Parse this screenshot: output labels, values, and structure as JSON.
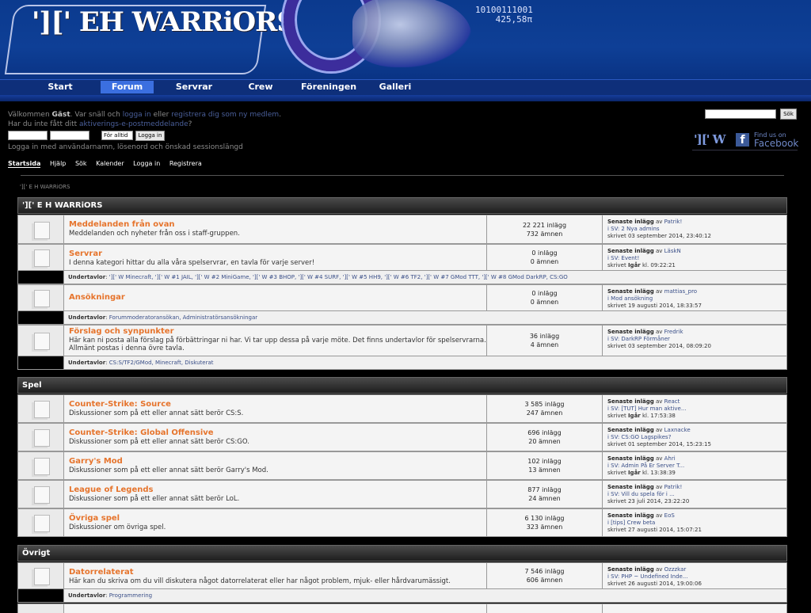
{
  "header": {
    "logo_text": "'][' EH WARRiORS",
    "binary_line1": "10100111001",
    "binary_line2": "425,58π"
  },
  "nav": {
    "items": [
      "Start",
      "Forum",
      "Servrar",
      "Crew",
      "Föreningen",
      "Galleri"
    ],
    "active": "Forum"
  },
  "welcome": {
    "prefix": "Välkommen",
    "guest": "Gäst",
    "please": ". Var snäll och",
    "login_link": "logga in",
    "or": "eller",
    "register_link": "registrera dig som ny medlem",
    "line2_prefix": "Har du inte fått ditt",
    "activation_link": "aktiverings-e-postmeddelande",
    "login_hint": "Logga in med användarnamn, lösenord och önskad sessionslängd"
  },
  "login": {
    "session_option": "För alltid",
    "button": "Logga in"
  },
  "search": {
    "button": "Sök"
  },
  "facebook": {
    "short": "'][' W",
    "find_us": "Find us on",
    "name": "Facebook"
  },
  "menu": [
    "Startsida",
    "Hjälp",
    "Sök",
    "Kalender",
    "Logga in",
    "Registrera"
  ],
  "breadcrumb": "'][' E H WARRiORS",
  "categories": [
    {
      "name": "'][' E H WARRiORS"
    },
    {
      "name": "Spel"
    },
    {
      "name": "Övrigt"
    }
  ],
  "boards": [
    {
      "title": "Meddelanden från ovan",
      "desc": "Meddelanden och nyheter från oss i staff-gruppen.",
      "posts": "22 221 inlägg",
      "topics": "732 ämnen",
      "last_label": "Senaste inlägg",
      "last_by": "av",
      "last_user": "Patrik!",
      "last_topic": "i SV: 2 Nya admins",
      "last_time": "skrivet 03 september 2014, 23:40:12"
    },
    {
      "title": "Servrar",
      "desc": "I denna kategori hittar du alla våra spelservrar, en tavla för varje server!",
      "posts": "0 inlägg",
      "topics": "0 ämnen",
      "last_label": "Senaste inlägg",
      "last_by": "av",
      "last_user": "LäskN",
      "last_topic": "i SV: Event!",
      "last_time_prefix": "skrivet",
      "last_time_bold": "Igår",
      "last_time_rest": "kl. 09:22:21"
    },
    {
      "title": "Ansökningar",
      "desc": "",
      "posts": "0 inlägg",
      "topics": "0 ämnen",
      "last_label": "Senaste inlägg",
      "last_by": "av",
      "last_user": "mattias_pro",
      "last_topic": "i Mod ansökning",
      "last_time": "skrivet 19 augusti 2014, 18:33:57"
    },
    {
      "title": "Förslag och synpunkter",
      "desc": "Här kan ni posta alla förslag på förbättringar ni har. Vi tar upp dessa på varje möte. Det finns undertavlor för spelservrarna.",
      "desc2": "Allmänt postas i denna övre tavla.",
      "posts": "36 inlägg",
      "topics": "4 ämnen",
      "last_label": "Senaste inlägg",
      "last_by": "av",
      "last_user": "Fredrik",
      "last_topic": "i SV: DarkRP Förmåner",
      "last_time": "skrivet 03 september 2014, 08:09:20"
    },
    {
      "title": "Counter-Strike: Source",
      "desc": "Diskussioner som på ett eller annat sätt berör CS:S.",
      "posts": "3 585 inlägg",
      "topics": "247 ämnen",
      "last_label": "Senaste inlägg",
      "last_by": "av",
      "last_user": "React",
      "last_topic": "i SV: [TUT] Hur man aktive...",
      "last_time_prefix": "skrivet",
      "last_time_bold": "Igår",
      "last_time_rest": "kl. 17:53:38"
    },
    {
      "title": "Counter-Strike: Global Offensive",
      "desc": "Diskussioner som på ett eller annat sätt berör CS:GO.",
      "posts": "696 inlägg",
      "topics": "20 ämnen",
      "last_label": "Senaste inlägg",
      "last_by": "av",
      "last_user": "Laxnacke",
      "last_topic": "i SV: CS:GO Lagspikes?",
      "last_time": "skrivet 01 september 2014, 15:23:15"
    },
    {
      "title": "Garry's Mod",
      "desc": "Diskussioner som på ett eller annat sätt berör Garry's Mod.",
      "posts": "102 inlägg",
      "topics": "13 ämnen",
      "last_label": "Senaste inlägg",
      "last_by": "av",
      "last_user": "Ahri",
      "last_topic": "i SV: Admin På Er Server T...",
      "last_time_prefix": "skrivet",
      "last_time_bold": "Igår",
      "last_time_rest": "kl. 13:38:39"
    },
    {
      "title": "League of Legends",
      "desc": "Diskussioner som på ett eller annat sätt berör LoL.",
      "posts": "877 inlägg",
      "topics": "24 ämnen",
      "last_label": "Senaste inlägg",
      "last_by": "av",
      "last_user": "Patrik!",
      "last_topic": "i SV: Vill du spela för i ...",
      "last_time": "skrivet 23 juli 2014, 23:22:20"
    },
    {
      "title": "Övriga spel",
      "desc": "Diskussioner om övriga spel.",
      "posts": "6 130 inlägg",
      "topics": "323 ämnen",
      "last_label": "Senaste inlägg",
      "last_by": "av",
      "last_user": "EoS",
      "last_topic": "i [tips] Crew beta",
      "last_time": "skrivet 27 augusti 2014, 15:07:21"
    },
    {
      "title": "Datorrelaterat",
      "desc": "Här kan du skriva om du vill diskutera något datorrelaterat eller har något problem, mjuk- eller hårdvarumässigt.",
      "posts": "7 546 inlägg",
      "topics": "606 ämnen",
      "last_label": "Senaste inlägg",
      "last_by": "av",
      "last_user": "Ozzzkar",
      "last_topic": "i SV: PHP ~ Undefined Inde...",
      "last_time": "skrivet 26 augusti 2014, 19:00:06"
    }
  ],
  "subboards": {
    "label": "Undertavlor",
    "servrar": "'][' W Minecraft, '][' W #1 JAIL, '][' W #2 MiniGame, '][' W #3 BHOP, '][' W #4 SURF, '][' W #5 HH9, '][' W #6 TF2, '][' W #7 GMod TTT, '][' W #8 GMod DarkRP, CS:GO",
    "ansokningar": "Forummoderatoransökan, Administratörsansökningar",
    "forslag": "CS:S/TF2/GMod, Minecraft, Diskuterat",
    "datorrelaterat": "Programmering"
  }
}
